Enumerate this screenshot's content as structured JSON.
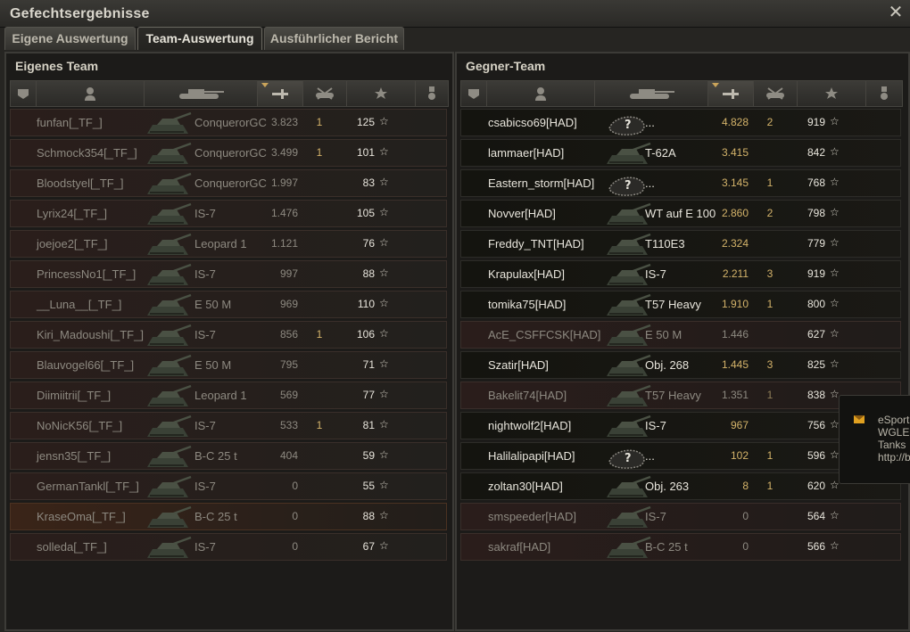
{
  "window": {
    "title": "Gefechtsergebnisse",
    "close_icon": "close-icon"
  },
  "tabs": [
    {
      "label": "Eigene Auswertung",
      "active": false
    },
    {
      "label": "Team-Auswertung",
      "active": true
    },
    {
      "label": "Ausführlicher Bericht",
      "active": false
    }
  ],
  "columns": [
    "platoon-icon",
    "player-icon",
    "tank-icon",
    "damage-icon",
    "kills-icon",
    "xp-star-icon",
    "medal-icon"
  ],
  "own_team": {
    "title": "Eigenes Team",
    "rows": [
      {
        "player": "funfan[_TF_]",
        "tank": "ConquerorGC",
        "damage": "3.823",
        "kills": "1",
        "xp": "125",
        "status": "dead"
      },
      {
        "player": "Schmock354[_TF_]",
        "tank": "ConquerorGC",
        "damage": "3.499",
        "kills": "1",
        "xp": "101",
        "status": "dead"
      },
      {
        "player": "Bloodstyel[_TF_]",
        "tank": "ConquerorGC",
        "damage": "1.997",
        "kills": "",
        "xp": "83",
        "status": "dead"
      },
      {
        "player": "Lyrix24[_TF_]",
        "tank": "IS-7",
        "damage": "1.476",
        "kills": "",
        "xp": "105",
        "status": "dead"
      },
      {
        "player": "joejoe2[_TF_]",
        "tank": "Leopard 1",
        "damage": "1.121",
        "kills": "",
        "xp": "76",
        "status": "dead"
      },
      {
        "player": "PrincessNo1[_TF_]",
        "tank": "IS-7",
        "damage": "997",
        "kills": "",
        "xp": "88",
        "status": "dead"
      },
      {
        "player": "__Luna__[_TF_]",
        "tank": "E 50 M",
        "damage": "969",
        "kills": "",
        "xp": "110",
        "status": "dead"
      },
      {
        "player": "Kiri_Madoushi[_TF_]",
        "tank": "IS-7",
        "damage": "856",
        "kills": "1",
        "xp": "106",
        "status": "dead"
      },
      {
        "player": "Blauvogel66[_TF_]",
        "tank": "E 50 M",
        "damage": "795",
        "kills": "",
        "xp": "71",
        "status": "dead"
      },
      {
        "player": "Diimiitrii[_TF_]",
        "tank": "Leopard 1",
        "damage": "569",
        "kills": "",
        "xp": "77",
        "status": "dead"
      },
      {
        "player": "NoNicK56[_TF_]",
        "tank": "IS-7",
        "damage": "533",
        "kills": "1",
        "xp": "81",
        "status": "dead"
      },
      {
        "player": "jensn35[_TF_]",
        "tank": "B-C 25 t",
        "damage": "404",
        "kills": "",
        "xp": "59",
        "status": "dead"
      },
      {
        "player": "GermanTankl[_TF_]",
        "tank": "IS-7",
        "damage": "0",
        "kills": "",
        "xp": "55",
        "status": "dead"
      },
      {
        "player": "KraseOma[_TF_]",
        "tank": "B-C 25 t",
        "damage": "0",
        "kills": "",
        "xp": "88",
        "status": "self"
      },
      {
        "player": "solleda[_TF_]",
        "tank": "IS-7",
        "damage": "0",
        "kills": "",
        "xp": "67",
        "status": "dead"
      }
    ]
  },
  "enemy_team": {
    "title": "Gegner-Team",
    "rows": [
      {
        "player": "csabicso69[HAD]",
        "tank": "...",
        "damage": "4.828",
        "kills": "2",
        "xp": "919",
        "status": "alive",
        "unknown": true
      },
      {
        "player": "lammaer[HAD]",
        "tank": "T-62A",
        "damage": "3.415",
        "kills": "",
        "xp": "842",
        "status": "alive"
      },
      {
        "player": "Eastern_storm[HAD]",
        "tank": "...",
        "damage": "3.145",
        "kills": "1",
        "xp": "768",
        "status": "alive",
        "unknown": true
      },
      {
        "player": "Novver[HAD]",
        "tank": "WT auf E 100",
        "damage": "2.860",
        "kills": "2",
        "xp": "798",
        "status": "alive"
      },
      {
        "player": "Freddy_TNT[HAD]",
        "tank": "T110E3",
        "damage": "2.324",
        "kills": "",
        "xp": "779",
        "status": "alive"
      },
      {
        "player": "Krapulax[HAD]",
        "tank": "IS-7",
        "damage": "2.211",
        "kills": "3",
        "xp": "919",
        "status": "alive"
      },
      {
        "player": "tomika75[HAD]",
        "tank": "T57 Heavy",
        "damage": "1.910",
        "kills": "1",
        "xp": "800",
        "status": "alive"
      },
      {
        "player": "AcE_CSFFCSK[HAD]",
        "tank": "E 50 M",
        "damage": "1.446",
        "kills": "",
        "xp": "627",
        "status": "dead"
      },
      {
        "player": "Szatir[HAD]",
        "tank": "Obj. 268",
        "damage": "1.445",
        "kills": "3",
        "xp": "825",
        "status": "alive"
      },
      {
        "player": "Bakelit74[HAD]",
        "tank": "T57 Heavy",
        "damage": "1.351",
        "kills": "1",
        "xp": "838",
        "status": "dead"
      },
      {
        "player": "nightwolf2[HAD]",
        "tank": "IS-7",
        "damage": "967",
        "kills": "",
        "xp": "756",
        "status": "alive"
      },
      {
        "player": "Halilalipapi[HAD]",
        "tank": "...",
        "damage": "102",
        "kills": "1",
        "xp": "596",
        "status": "alive",
        "unknown": true
      },
      {
        "player": "zoltan30[HAD]",
        "tank": "Obj. 263",
        "damage": "8",
        "kills": "1",
        "xp": "620",
        "status": "alive"
      },
      {
        "player": "smspeeder[HAD]",
        "tank": "IS-7",
        "damage": "0",
        "kills": "",
        "xp": "564",
        "status": "dead"
      },
      {
        "player": "sakraf[HAD]",
        "tank": "B-C 25 t",
        "damage": "0",
        "kills": "",
        "xp": "566",
        "status": "dead"
      }
    ]
  },
  "notification": {
    "icon": "mail-icon",
    "text": "eSport\nWGLEU\nTanks\nhttp://b"
  },
  "colors": {
    "damage_gold": "#d4b36a",
    "dead_text": "#8d8980",
    "alive_text": "#e8e5dc"
  }
}
